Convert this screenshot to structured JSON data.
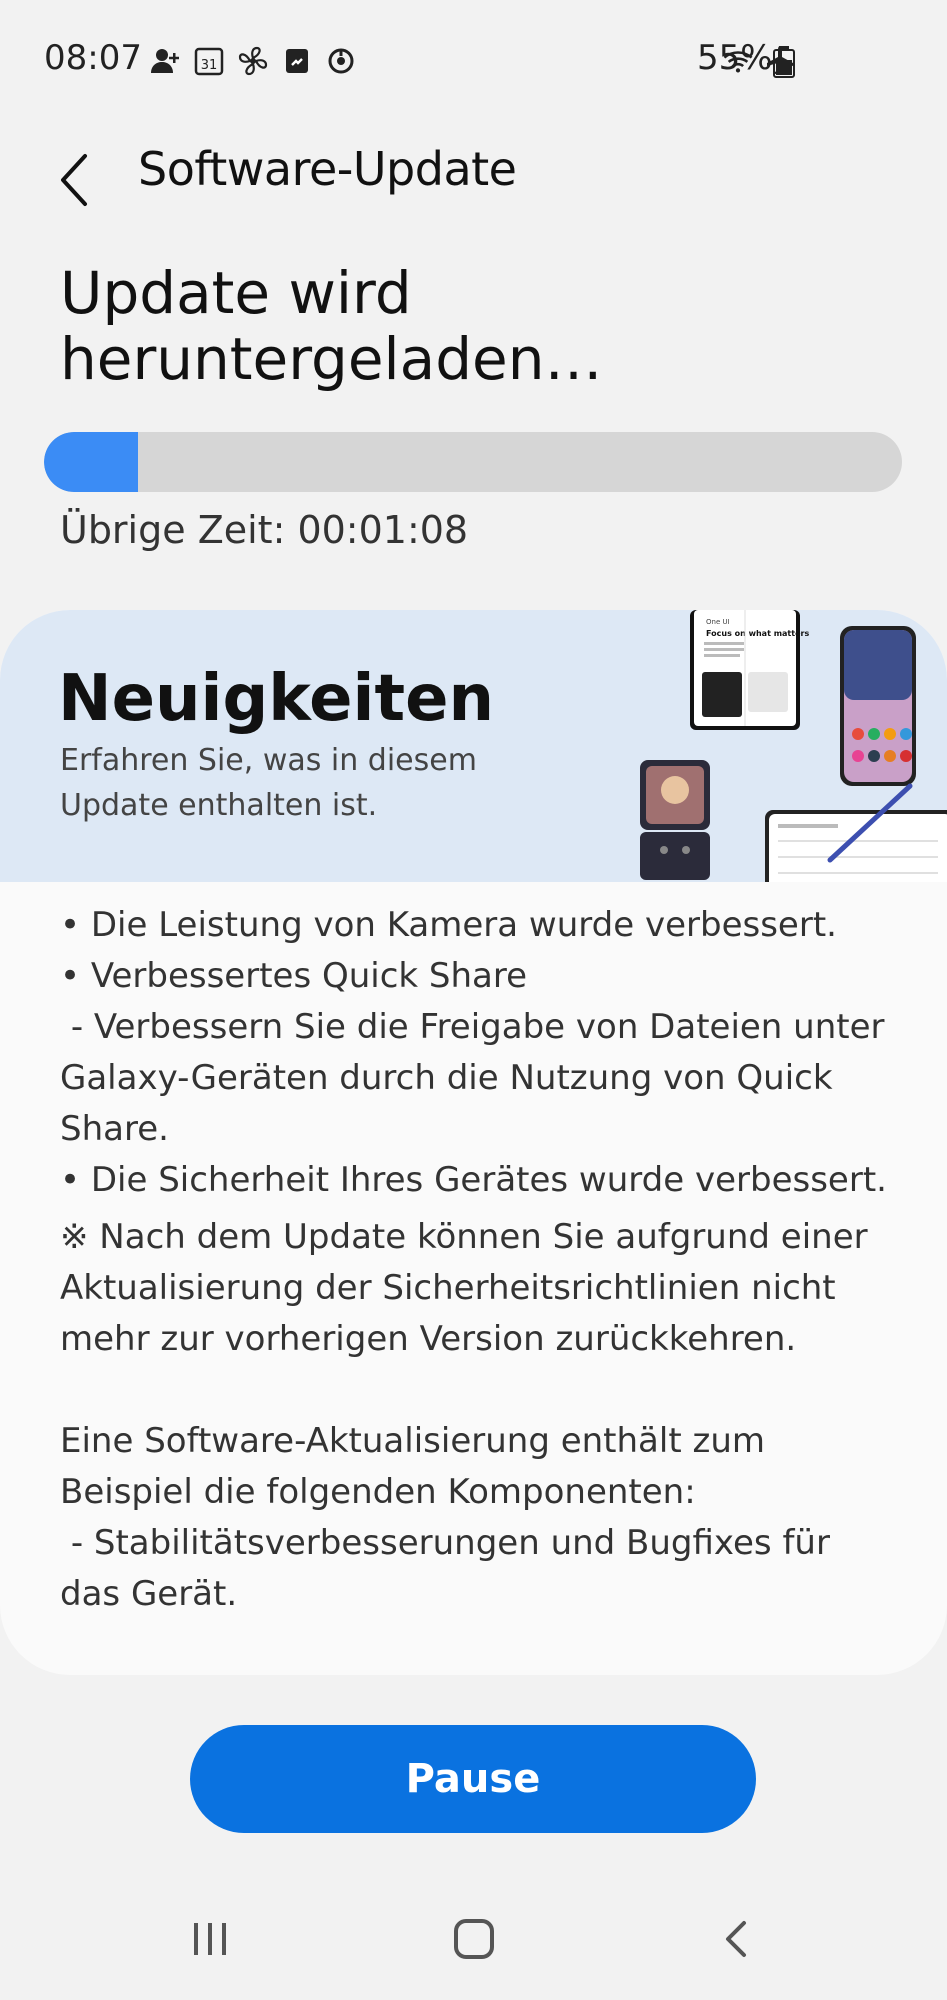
{
  "status_bar": {
    "time": "08:07",
    "battery_percent": "55%",
    "left_icons": [
      "add-person-icon",
      "calendar-31-icon",
      "fan-icon",
      "phone-icon",
      "sync-icon"
    ],
    "right_icons": [
      "wifi-icon",
      "airplane-icon",
      "battery-icon"
    ],
    "calendar_day": "31"
  },
  "header": {
    "title": "Software-Update"
  },
  "download": {
    "title": "Update wird heruntergeladen…",
    "progress": 0.11,
    "remaining": "Übrige Zeit: 00:01:08"
  },
  "news": {
    "heading": "Neuigkeiten",
    "subtitle": "Erfahren Sie, was in diesem Update enthalten ist.",
    "body": [
      "• Die Leistung von Kamera wurde verbessert.",
      "• Verbessertes Quick Share",
      " - Verbessern Sie die Freigabe von Dateien unter Galaxy-Geräten durch die Nutzung von Quick Share.",
      "• Die Sicherheit Ihres Gerätes wurde verbessert.",
      "※ Nach dem Update können Sie aufgrund einer Aktualisierung der Sicherheitsrichtlinien nicht mehr zur vorherigen Version zurückkehren.",
      "",
      "Eine Software-Aktualisierung enthält zum Beispiel die folgenden Komponenten:",
      " - Stabilitätsverbesserungen und Bugfixes für das Gerät."
    ],
    "banner_image_text": {
      "tablet_title": "Focus on what matters",
      "tablet_kicker": "One UI"
    }
  },
  "actions": {
    "pause_label": "Pause"
  },
  "nav": {
    "items": [
      "recents-icon",
      "home-icon",
      "back-icon"
    ]
  },
  "colors": {
    "accent": "#0a72e0",
    "progress": "#3b8cf5",
    "banner": "#dde8f5"
  }
}
